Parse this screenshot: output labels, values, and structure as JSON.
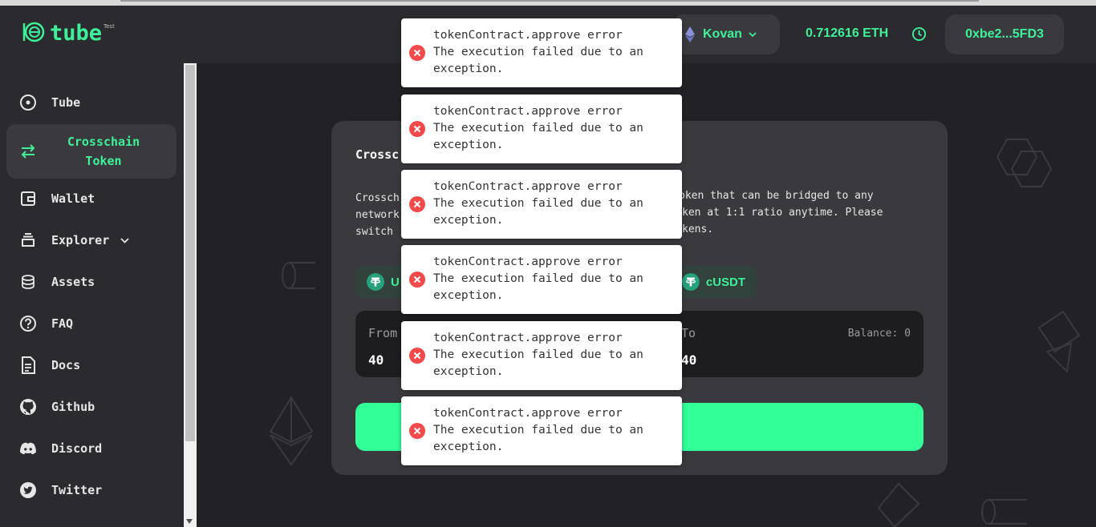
{
  "app": {
    "name": "tube",
    "badge": "Test"
  },
  "header": {
    "network": "Kovan",
    "balance": "0.712616 ETH",
    "address": "0xbe2...5FD3"
  },
  "sidebar": {
    "items": [
      {
        "label": "Tube",
        "icon": "disc-icon"
      },
      {
        "label": "Crosschain Token",
        "icon": "swap-arrows-icon",
        "active": true
      },
      {
        "label": "Wallet",
        "icon": "wallet-icon"
      },
      {
        "label": "Explorer",
        "icon": "stack-icon",
        "has_submenu": true
      },
      {
        "label": "Assets",
        "icon": "coins-icon"
      },
      {
        "label": "FAQ",
        "icon": "question-icon"
      },
      {
        "label": "Docs",
        "icon": "document-icon"
      },
      {
        "label": "Github",
        "icon": "github-icon"
      },
      {
        "label": "Discord",
        "icon": "discord-icon"
      },
      {
        "label": "Twitter",
        "icon": "twitter-icon"
      }
    ]
  },
  "card": {
    "title": "Crossc",
    "desc_left": [
      "Crossch",
      "network",
      "switch"
    ],
    "desc_right": [
      "oken that can be bridged to any",
      "ken at 1:1 ratio anytime. Please",
      "kens."
    ],
    "from_token": "U",
    "to_token": "cUSDT",
    "from_label": "From",
    "from_value": "40",
    "to_label": "To",
    "to_value": "40",
    "to_balance": "Balance: 0"
  },
  "toasts": [
    {
      "line1": "tokenContract.approve error",
      "line2": "The execution failed due to an",
      "line3": "exception."
    },
    {
      "line1": "tokenContract.approve error",
      "line2": "The execution failed due to an",
      "line3": "exception."
    },
    {
      "line1": "tokenContract.approve error",
      "line2": "The execution failed due to an",
      "line3": "exception."
    },
    {
      "line1": "tokenContract.approve error",
      "line2": "The execution failed due to an",
      "line3": "exception."
    },
    {
      "line1": "tokenContract.approve error",
      "line2": "The execution failed due to an",
      "line3": "exception."
    },
    {
      "line1": "tokenContract.approve error",
      "line2": "The execution failed due to an",
      "line3": "exception."
    }
  ],
  "colors": {
    "accent": "#3ff09a",
    "button": "#33ff99",
    "error": "#f24a4a",
    "background": "#222226",
    "panel": "#2b2b2f",
    "card": "#3a3a3e"
  }
}
